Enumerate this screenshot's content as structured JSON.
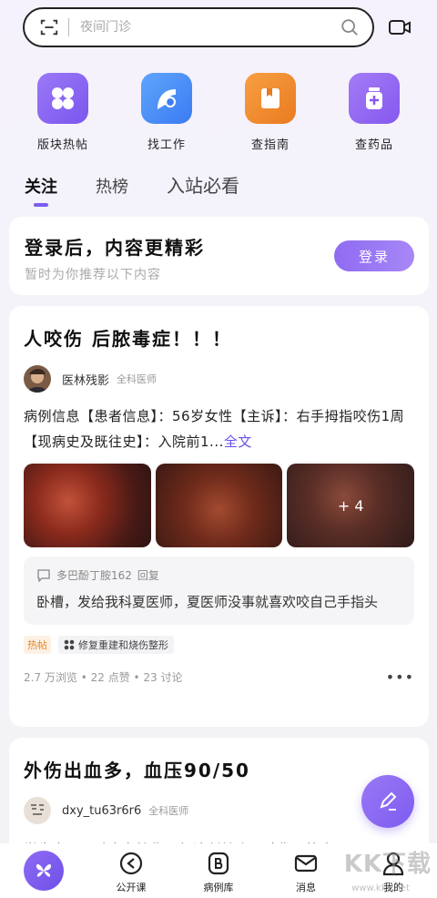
{
  "search": {
    "placeholder": "夜间门诊"
  },
  "quick_links": [
    {
      "label": "版块热帖",
      "color": "#8a63f0",
      "icon": "grid-icon"
    },
    {
      "label": "找工作",
      "color": "#4b8ff7",
      "icon": "job-icon"
    },
    {
      "label": "查指南",
      "color": "#f08a2b",
      "icon": "book-icon"
    },
    {
      "label": "查药品",
      "color": "#9a6cf2",
      "icon": "medicine-icon"
    }
  ],
  "tabs": [
    {
      "label": "关注",
      "active": true
    },
    {
      "label": "热榜",
      "active": false
    },
    {
      "label": "入站必看",
      "active": false
    }
  ],
  "login_card": {
    "title": "登录后，内容更精彩",
    "subtitle": "暂时为你推荐以下内容",
    "button": "登录"
  },
  "post1": {
    "title": "人咬伤 后脓毒症！！！",
    "author": "医林残影",
    "role": "全科医师",
    "body": "病例信息【患者信息】：56岁女性【主诉】：右手拇指咬伤1周【现病史及既往史】：入院前1...",
    "fulltext": "全文",
    "more_images": "+ 4",
    "reply_user": "多巴酚丁胺162",
    "reply_label": "回复",
    "reply_text": "卧槽，发给我科夏医师，夏医师没事就喜欢咬自己手指头",
    "tag_hot": "热帖",
    "tag_topic": "修复重建和烧伤整形",
    "stats": "2.7 万浏览 • 22 点赞 • 23 讨论",
    "more": "•••"
  },
  "post2": {
    "title": "外伤出血多，血压90/50",
    "author": "dxy_tu63r6r6",
    "role": "全科医师",
    "body": "学生十五，骑电车摔伤，经清创缝合，破伤风抗毒"
  },
  "bottom_nav": [
    {
      "label": "",
      "icon": "home-butterfly-icon"
    },
    {
      "label": "公开课",
      "icon": "play-circle-icon"
    },
    {
      "label": "病例库",
      "icon": "case-library-icon"
    },
    {
      "label": "消息",
      "icon": "mail-icon"
    },
    {
      "label": "我的",
      "icon": "user-icon"
    }
  ],
  "watermark": {
    "main": "KK下载",
    "sub": "www.kkx.net"
  },
  "colors": {
    "accent": "#7b5cf0",
    "fulltext": "#6b4fe6",
    "hot": "#e58a2a"
  }
}
